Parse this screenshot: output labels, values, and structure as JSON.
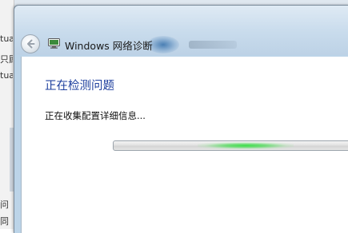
{
  "background_window": {
    "fragments": [
      "tua",
      "只顾",
      "tua",
      "问",
      "同"
    ]
  },
  "dialog": {
    "title": "Windows 网络诊断",
    "heading": "正在检测问题",
    "status": "正在收集配置详细信息...",
    "progress": {
      "style": "indeterminate",
      "color": "#3de04a"
    }
  },
  "colors": {
    "heading": "#1e3f9e",
    "titlebar": "#c8dbec"
  }
}
